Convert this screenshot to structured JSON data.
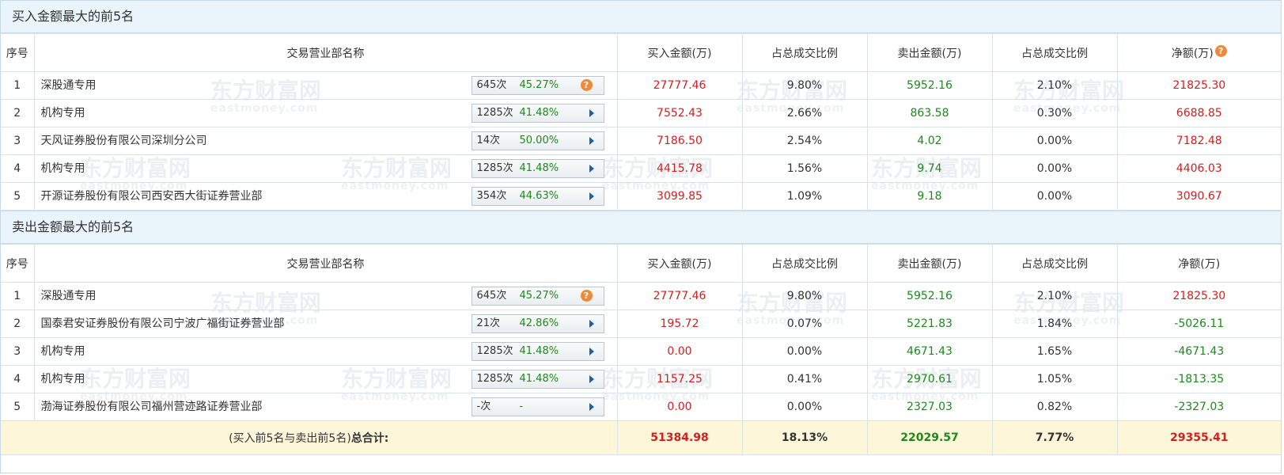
{
  "buy_section": {
    "title": "买入金额最大的前5名",
    "headers": [
      "序号",
      "交易营业部名称",
      "买入金额(万)",
      "占总成交比例",
      "卖出金额(万)",
      "占总成交比例",
      "净额(万)"
    ],
    "net_help_icon": "?",
    "rows": [
      {
        "idx": "1",
        "name": "深股通专用",
        "count": "645次",
        "pct": "45.27%",
        "control": "help",
        "buy": "27777.46",
        "buy_ratio": "9.80%",
        "sell": "5952.16",
        "sell_ratio": "2.10%",
        "net": "21825.30",
        "net_color": "red"
      },
      {
        "idx": "2",
        "name": "机构专用",
        "count": "1285次",
        "pct": "41.48%",
        "control": "arrow",
        "buy": "7552.43",
        "buy_ratio": "2.66%",
        "sell": "863.58",
        "sell_ratio": "0.30%",
        "net": "6688.85",
        "net_color": "red"
      },
      {
        "idx": "3",
        "name": "天风证券股份有限公司深圳分公司",
        "count": "14次",
        "pct": "50.00%",
        "control": "arrow",
        "buy": "7186.50",
        "buy_ratio": "2.54%",
        "sell": "4.02",
        "sell_ratio": "0.00%",
        "net": "7182.48",
        "net_color": "red"
      },
      {
        "idx": "4",
        "name": "机构专用",
        "count": "1285次",
        "pct": "41.48%",
        "control": "arrow",
        "buy": "4415.78",
        "buy_ratio": "1.56%",
        "sell": "9.74",
        "sell_ratio": "0.00%",
        "net": "4406.03",
        "net_color": "red"
      },
      {
        "idx": "5",
        "name": "开源证券股份有限公司西安西大街证券营业部",
        "count": "354次",
        "pct": "44.63%",
        "control": "arrow",
        "buy": "3099.85",
        "buy_ratio": "1.09%",
        "sell": "9.18",
        "sell_ratio": "0.00%",
        "net": "3090.67",
        "net_color": "red"
      }
    ]
  },
  "sell_section": {
    "title": "卖出金额最大的前5名",
    "headers": [
      "序号",
      "交易营业部名称",
      "买入金额(万)",
      "占总成交比例",
      "卖出金额(万)",
      "占总成交比例",
      "净额(万)"
    ],
    "rows": [
      {
        "idx": "1",
        "name": "深股通专用",
        "count": "645次",
        "pct": "45.27%",
        "control": "help",
        "buy": "27777.46",
        "buy_ratio": "9.80%",
        "sell": "5952.16",
        "sell_ratio": "2.10%",
        "net": "21825.30",
        "net_color": "red"
      },
      {
        "idx": "2",
        "name": "国泰君安证券股份有限公司宁波广福街证券营业部",
        "count": "21次",
        "pct": "42.86%",
        "control": "arrow",
        "buy": "195.72",
        "buy_ratio": "0.07%",
        "sell": "5221.83",
        "sell_ratio": "1.84%",
        "net": "-5026.11",
        "net_color": "green"
      },
      {
        "idx": "3",
        "name": "机构专用",
        "count": "1285次",
        "pct": "41.48%",
        "control": "arrow",
        "buy": "0.00",
        "buy_ratio": "0.00%",
        "sell": "4671.43",
        "sell_ratio": "1.65%",
        "net": "-4671.43",
        "net_color": "green"
      },
      {
        "idx": "4",
        "name": "机构专用",
        "count": "1285次",
        "pct": "41.48%",
        "control": "arrow",
        "buy": "1157.25",
        "buy_ratio": "0.41%",
        "sell": "2970.61",
        "sell_ratio": "1.05%",
        "net": "-1813.35",
        "net_color": "green"
      },
      {
        "idx": "5",
        "name": "渤海证券股份有限公司福州营迹路证券营业部",
        "count": "-次",
        "pct": "-",
        "control": "arrow",
        "buy": "0.00",
        "buy_ratio": "0.00%",
        "sell": "2327.03",
        "sell_ratio": "0.82%",
        "net": "-2327.03",
        "net_color": "green"
      }
    ]
  },
  "total": {
    "label_prefix": "(买入前5名与卖出前5名)",
    "label_bold": "总合计:",
    "buy": "51384.98",
    "buy_ratio": "18.13%",
    "sell": "22029.57",
    "sell_ratio": "7.77%",
    "net": "29355.41"
  },
  "watermark": {
    "text": "东方财富网",
    "sub": "eastmoney.com"
  },
  "colors": {
    "red": "#d21f1f",
    "green": "#1b8a1b",
    "header_bg": "#eaf5fb",
    "total_bg": "#fdf6d8",
    "help_icon": "#f08a3a",
    "arrow": "#1d5fa8"
  },
  "icons": {
    "help": "question-icon",
    "expand": "expand-arrow-icon"
  }
}
